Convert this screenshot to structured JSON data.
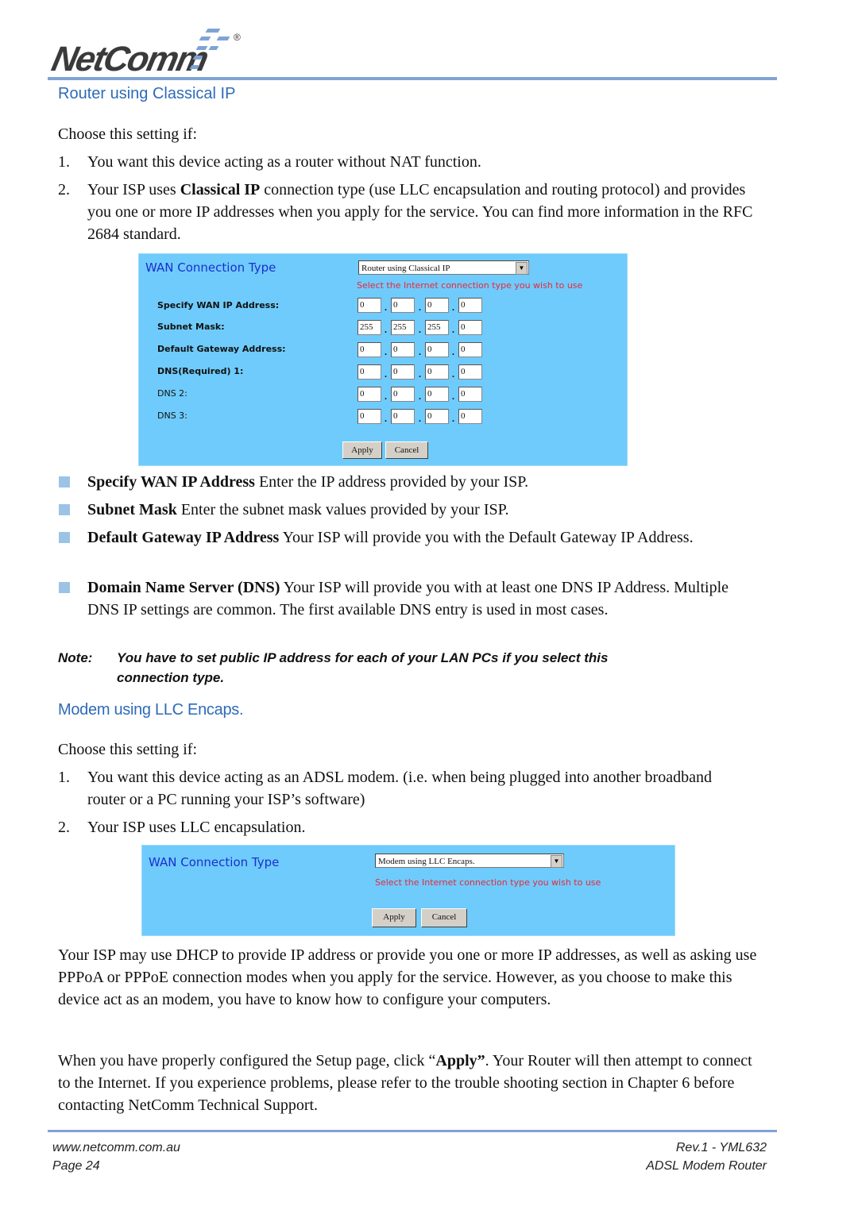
{
  "header": {
    "logo_text": "NetComm",
    "logo_reg": "®",
    "section1_title": "Router using Classical IP"
  },
  "section1": {
    "intro": "Choose this setting if:",
    "items": [
      {
        "num": "1.",
        "text": "You want this device acting as a router without NAT function."
      },
      {
        "num": "2.",
        "pre": "Your ISP uses ",
        "bold": "Classical IP",
        "post": " connection type (use LLC encapsulation and routing protocol) and provides you one or more IP addresses when you apply for the service. You can find more information in the RFC 2684 standard."
      }
    ]
  },
  "panel1": {
    "title": "WAN Connection Type",
    "select_value": "Router using Classical IP",
    "hint": "Select the Internet connection type you wish to use",
    "fields": [
      {
        "label": "Specify WAN IP Address:",
        "values": [
          "0",
          "0",
          "0",
          "0"
        ]
      },
      {
        "label": "Subnet Mask:",
        "values": [
          "255",
          "255",
          "255",
          "0"
        ]
      },
      {
        "label": "Default Gateway Address:",
        "values": [
          "0",
          "0",
          "0",
          "0"
        ]
      },
      {
        "label": "DNS(Required)  1:",
        "values": [
          "0",
          "0",
          "0",
          "0"
        ]
      },
      {
        "label": "DNS   2:",
        "values": [
          "0",
          "0",
          "0",
          "0"
        ]
      },
      {
        "label": "DNS   3:",
        "values": [
          "0",
          "0",
          "0",
          "0"
        ]
      }
    ],
    "apply": "Apply",
    "cancel": "Cancel"
  },
  "bullets": [
    {
      "bold": "Specify WAN IP Address",
      "text": " Enter the IP address provided by your ISP."
    },
    {
      "bold": "Subnet Mask",
      "text": " Enter the subnet mask values provided by your ISP."
    },
    {
      "bold": "Default Gateway IP Address",
      "text": " Your ISP will provide you with the Default Gateway IP Address."
    },
    {
      "bold": "Domain Name Server (DNS)",
      "text": " Your ISP will provide you with at least one DNS IP Address. Multiple DNS IP settings are common. The first available DNS entry is used in most cases."
    }
  ],
  "note": {
    "label": "Note:",
    "line1": "You have to set public IP address for each of your LAN PCs if you select this",
    "line2": "connection type."
  },
  "section2": {
    "title": "Modem using LLC Encaps.",
    "intro": "Choose this setting if:",
    "items": [
      {
        "num": "1.",
        "text": "You want this device acting as an ADSL modem. (i.e. when being plugged into another broadband router or a PC running your ISP’s software)"
      },
      {
        "num": "2.",
        "text": "Your ISP uses LLC encapsulation."
      }
    ]
  },
  "panel2": {
    "title": "WAN Connection Type",
    "select_value": "Modem using LLC Encaps.",
    "hint": "Select the Internet connection type you wish to use",
    "apply": "Apply",
    "cancel": "Cancel"
  },
  "body_paragraphs": {
    "p1": "Your ISP may use DHCP to provide IP address or provide you one or more IP addresses, as well as asking use PPPoA or PPPoE connection modes when you apply for the service. However, as you choose to make this device act as an modem, you have to know how to configure your computers.",
    "p2_pre": "When you have properly configured the Setup page, click “",
    "p2_bold": "Apply”",
    "p2_post": ". Your Router will then attempt to connect to the Internet.  If you experience problems, please refer to the trouble shooting section in Chapter 6 before contacting NetComm Technical Support."
  },
  "footer": {
    "url": "www.netcomm.com.au",
    "page": "Page 24",
    "rev": "Rev.1 - YML632",
    "product": "ADSL Modem Router"
  }
}
